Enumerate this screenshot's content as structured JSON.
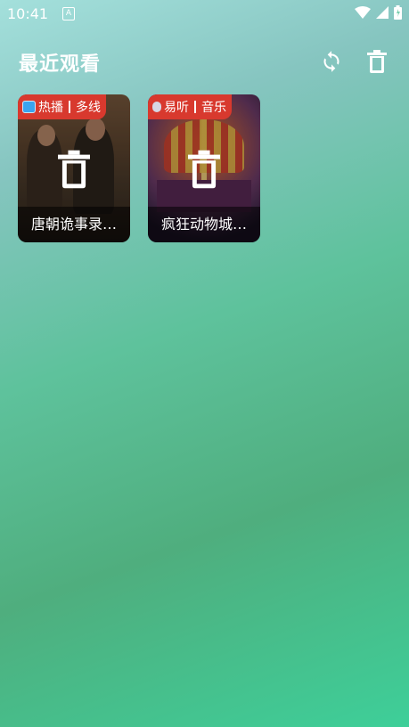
{
  "status_bar": {
    "time": "10:41",
    "notif_glyph": "A"
  },
  "header": {
    "title": "最近观看",
    "refresh_icon": "refresh-icon",
    "trash_icon": "trash-icon"
  },
  "cards": [
    {
      "tag_left": "热播",
      "tag_right": "多线",
      "title": "唐朝诡事录…"
    },
    {
      "tag_left": "易听",
      "tag_right": "音乐",
      "title": "疯狂动物城…"
    }
  ],
  "colors": {
    "tag_bg": "#d8392e",
    "accent_text": "#ffffff"
  }
}
